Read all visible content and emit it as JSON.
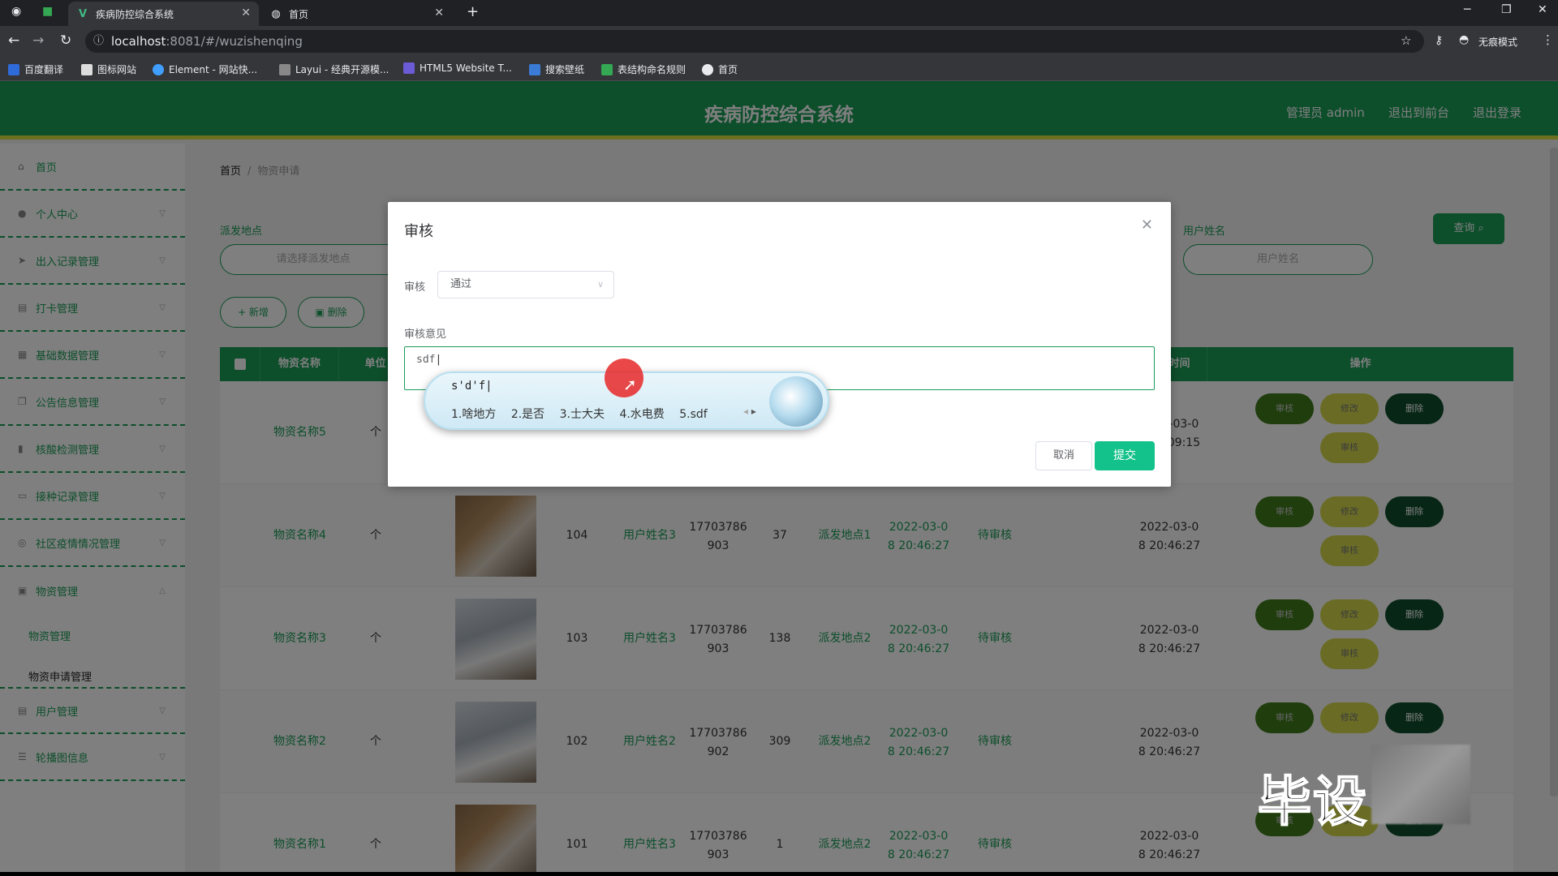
{
  "browser": {
    "tabs": [
      {
        "title": "疾病防控综合系统",
        "active": true
      },
      {
        "title": "首页",
        "active": false
      }
    ],
    "url_host": "localhost",
    "url_rest": ":8081/#/wuzishenqing",
    "incognito_label": "无痕模式",
    "bookmarks": [
      "百度翻译",
      "图标网站",
      "Element - 网站快...",
      "Layui - 经典开源模...",
      "HTML5 Website T...",
      "搜索壁纸",
      "表结构命名规则",
      "首页"
    ]
  },
  "header": {
    "title": "疾病防控综合系统",
    "admin_label": "管理员 admin",
    "exit_front": "退出到前台",
    "logout": "退出登录"
  },
  "sidebar": {
    "items": [
      "首页",
      "个人中心",
      "出入记录管理",
      "打卡管理",
      "基础数据管理",
      "公告信息管理",
      "核酸检测管理",
      "接种记录管理",
      "社区疫情情况管理",
      "物资管理",
      "用户管理",
      "轮播图信息"
    ],
    "submenu": [
      "物资管理",
      "物资申请管理"
    ]
  },
  "breadcrumb": {
    "home": "首页",
    "current": "物资申请"
  },
  "search": {
    "location_label": "派发地点",
    "location_placeholder": "请选择派发地点",
    "user_label": "用户姓名",
    "user_placeholder": "用户姓名",
    "query_label": "查询"
  },
  "toolbar": {
    "add_label": "+ 新增",
    "delete_label": "删除"
  },
  "table": {
    "headers": [
      "物资名称",
      "单位",
      "审核时间",
      "操作"
    ],
    "rows": [
      {
        "name": "物资名称5",
        "unit": "个",
        "review_time": "2022-03-08 21:09:15"
      },
      {
        "name": "物资名称4",
        "unit": "个",
        "num": "104",
        "user": "用户姓名3",
        "phone": "17703786903",
        "qty": "37",
        "place": "派发地点1",
        "apply_time": "2022-03-08 20:46:27",
        "status": "待审核",
        "review_time": "2022-03-08 20:46:27"
      },
      {
        "name": "物资名称3",
        "unit": "个",
        "num": "103",
        "user": "用户姓名3",
        "phone": "17703786903",
        "qty": "138",
        "place": "派发地点2",
        "apply_time": "2022-03-08 20:46:27",
        "status": "待审核",
        "review_time": "2022-03-08 20:46:27"
      },
      {
        "name": "物资名称2",
        "unit": "个",
        "num": "102",
        "user": "用户姓名2",
        "phone": "17703786902",
        "qty": "309",
        "place": "派发地点2",
        "apply_time": "2022-03-08 20:46:27",
        "status": "待审核",
        "review_time": "2022-03-08 20:46:27"
      },
      {
        "name": "物资名称1",
        "unit": "个",
        "num": "101",
        "user": "用户姓名3",
        "phone": "17703786903",
        "qty": "1",
        "place": "派发地点2",
        "apply_time": "2022-03-08 20:46:27",
        "status": "待审核",
        "review_time": "2022-03-08 20:46:27"
      }
    ],
    "actions": {
      "review": "审核",
      "edit": "修改",
      "delete": "删除",
      "audit": "审核"
    }
  },
  "dialog": {
    "title": "审核",
    "review_label": "审核",
    "review_value": "通过",
    "opinion_label": "审核意见",
    "opinion_value": "sdf",
    "cancel_label": "取消",
    "submit_label": "提交"
  },
  "ime": {
    "composition": "s'd'f",
    "candidates": [
      "1.啥地方",
      "2.是否",
      "3.士大夫",
      "4.水电费",
      "5.sdf"
    ]
  },
  "watermark": "毕设"
}
